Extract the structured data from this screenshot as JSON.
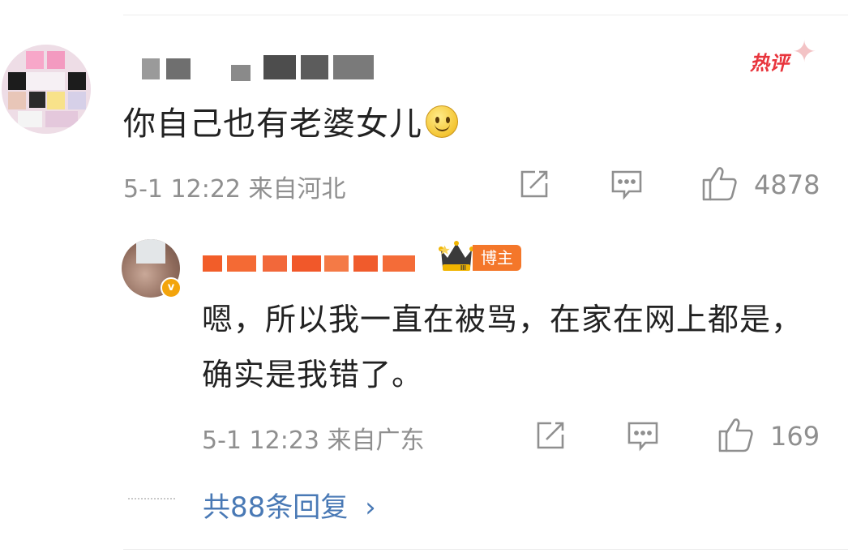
{
  "main_comment": {
    "text": "你自己也有老婆女儿",
    "hot_label": "热评",
    "time": "5-1 12:22",
    "location": "来自河北",
    "like_count": "4878"
  },
  "reply": {
    "badge_label": "博主",
    "verified_label": "v",
    "text": "嗯，所以我一直在被骂，在家在网上都是，确实是我错了。",
    "time": "5-1 12:23",
    "location": "来自广东",
    "like_count": "169"
  },
  "more_replies": {
    "label": "共88条回复",
    "chevron": "›"
  },
  "icons": {
    "share": "share-icon",
    "comment": "comment-icon",
    "like": "thumbs-up-icon",
    "crown": "crown-icon",
    "emoji": "smiley-emoji"
  },
  "colors": {
    "link_blue": "#4979b5",
    "hot_red": "#e8343c",
    "badge_orange": "#f4772a",
    "meta_gray": "#8f8f8f"
  }
}
